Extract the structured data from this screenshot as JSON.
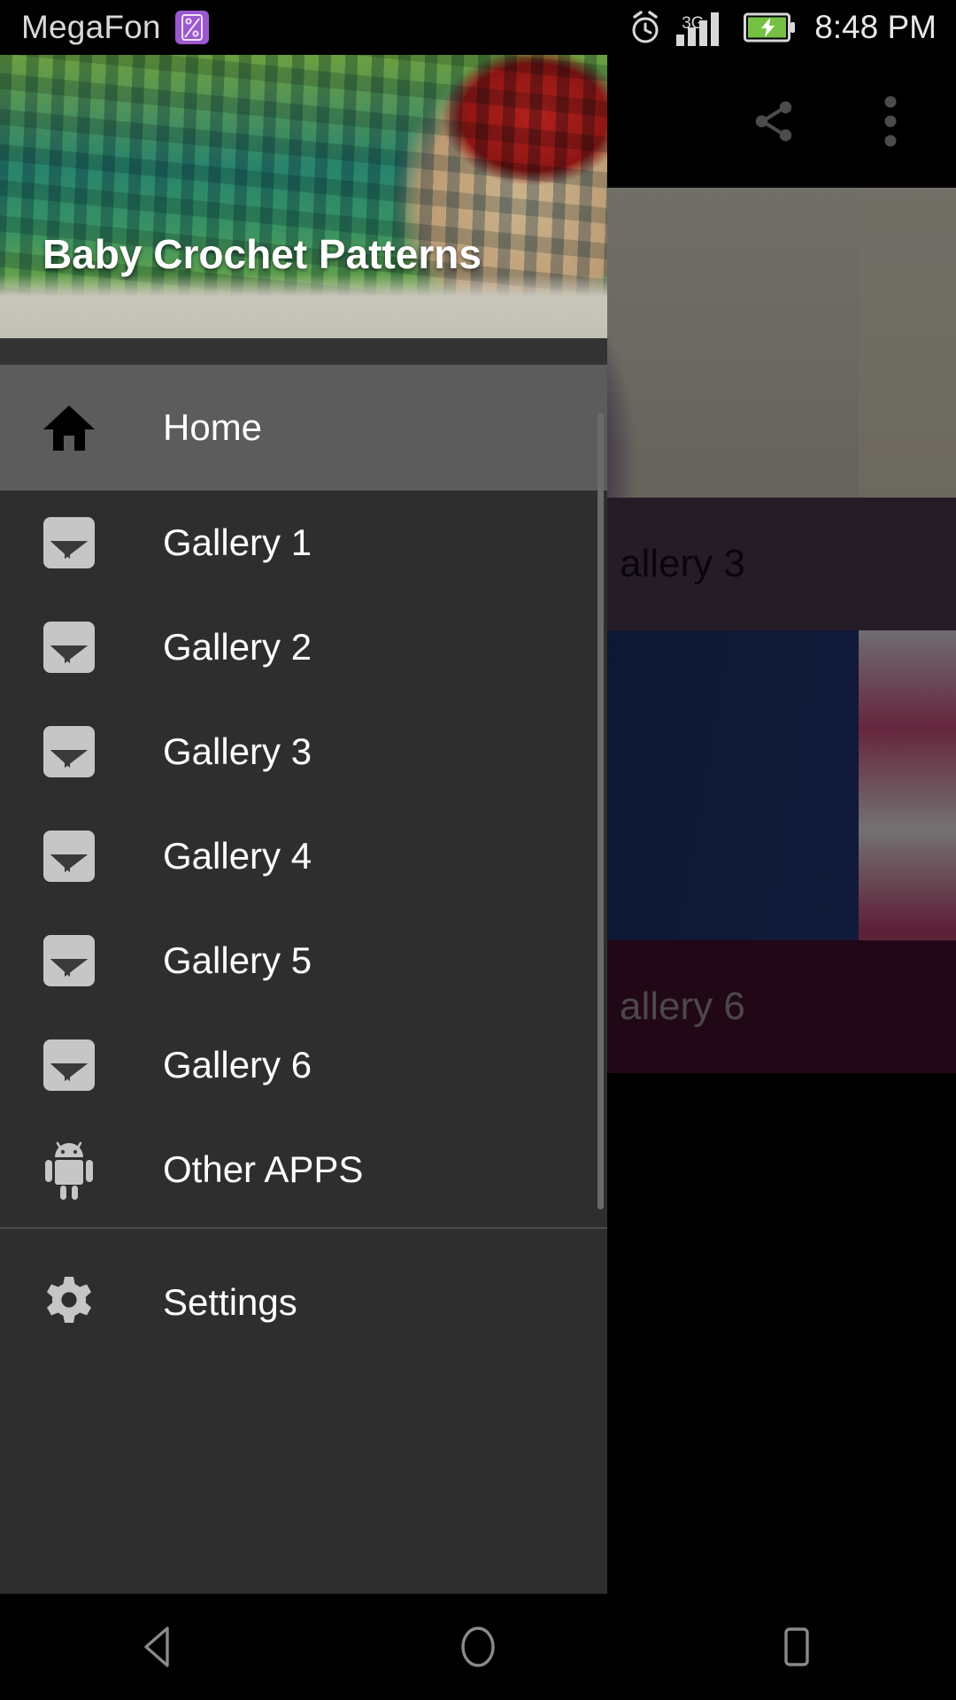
{
  "status_bar": {
    "carrier": "MegaFon",
    "carrier_badge_icon": "sim-photo-icon",
    "alarm_icon": "alarm-clock-icon",
    "network_type": "3G",
    "signal_icon": "signal-bars-icon",
    "battery_icon": "battery-charging-icon",
    "time": "8:48 PM"
  },
  "app_bar": {
    "share_label": "share-icon",
    "overflow_label": "overflow-menu-icon"
  },
  "drawer": {
    "header_title": "Baby Crochet Patterns",
    "items": [
      {
        "label": "Home",
        "icon": "home-icon",
        "selected": true
      },
      {
        "label": "Gallery 1",
        "icon": "photo-icon",
        "selected": false
      },
      {
        "label": "Gallery 2",
        "icon": "photo-icon",
        "selected": false
      },
      {
        "label": "Gallery 3",
        "icon": "photo-icon",
        "selected": false
      },
      {
        "label": "Gallery 4",
        "icon": "photo-icon",
        "selected": false
      },
      {
        "label": "Gallery 5",
        "icon": "photo-icon",
        "selected": false
      },
      {
        "label": "Gallery 6",
        "icon": "photo-icon",
        "selected": false
      },
      {
        "label": "Other APPS",
        "icon": "android-icon",
        "selected": false
      }
    ],
    "footer": {
      "label": "Settings",
      "icon": "gear-icon"
    }
  },
  "background_cards": [
    {
      "caption": "allery 3",
      "caption_bg": "#46334a",
      "caption_color": "#120a14"
    },
    {
      "caption": "allery 6",
      "caption_bg": "#3d0f2b",
      "caption_color": "#8d8189"
    }
  ],
  "nav_bar": {
    "back": "back-triangle-icon",
    "home": "home-circle-icon",
    "recents": "recents-square-icon"
  },
  "colors": {
    "drawer_bg": "#2e2e2e",
    "drawer_selected": "#5c5c5c",
    "accent_badge": "#9b59d0",
    "battery_green": "#76c043",
    "status_text": "#d8d8d8"
  }
}
